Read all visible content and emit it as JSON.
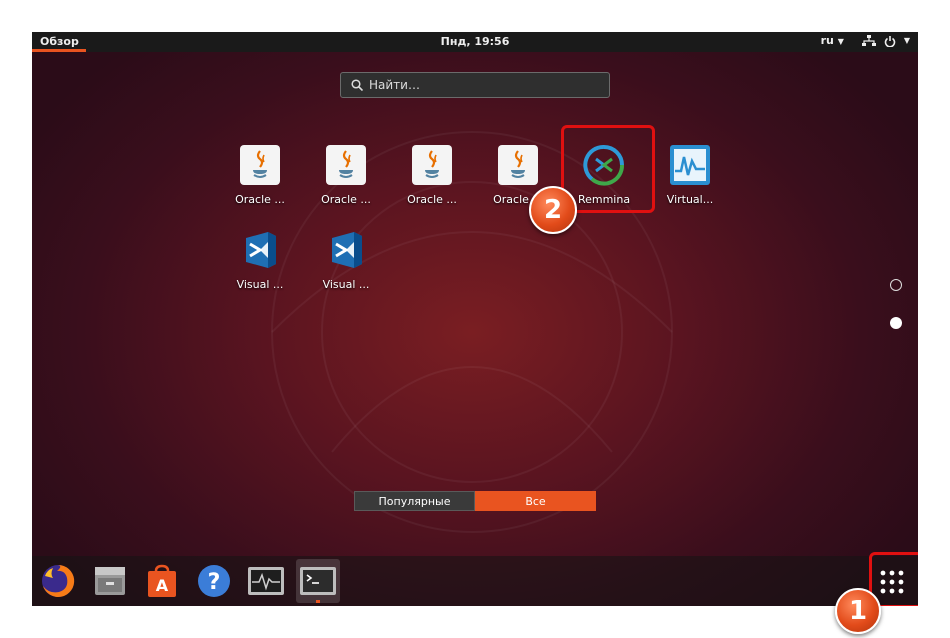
{
  "topbar": {
    "activities": "Обзор",
    "clock": "Пнд, 19:56",
    "language": "ru"
  },
  "search": {
    "placeholder": "Найти…"
  },
  "apps": [
    {
      "label": "Oracle ...",
      "icon": "java-icon"
    },
    {
      "label": "Oracle ...",
      "icon": "java-icon"
    },
    {
      "label": "Oracle ...",
      "icon": "java-icon"
    },
    {
      "label": "Oracle ...",
      "icon": "java-icon"
    },
    {
      "label": "Remmina",
      "icon": "remmina-icon"
    },
    {
      "label": "Virtual...",
      "icon": "virtualbox-monitor-icon"
    },
    {
      "label": "Visual ...",
      "icon": "vscode-icon"
    },
    {
      "label": "Visual ...",
      "icon": "vscode-icon"
    }
  ],
  "tabs": {
    "popular": "Популярные",
    "all": "Все"
  },
  "badges": {
    "one": "1",
    "two": "2"
  },
  "dock": [
    {
      "name": "firefox-icon"
    },
    {
      "name": "files-icon"
    },
    {
      "name": "software-icon"
    },
    {
      "name": "help-icon"
    },
    {
      "name": "system-monitor-icon"
    },
    {
      "name": "terminal-icon"
    }
  ],
  "colors": {
    "accent": "#e95420",
    "highlight": "#e01010",
    "topbar": "#1a1a1a"
  }
}
